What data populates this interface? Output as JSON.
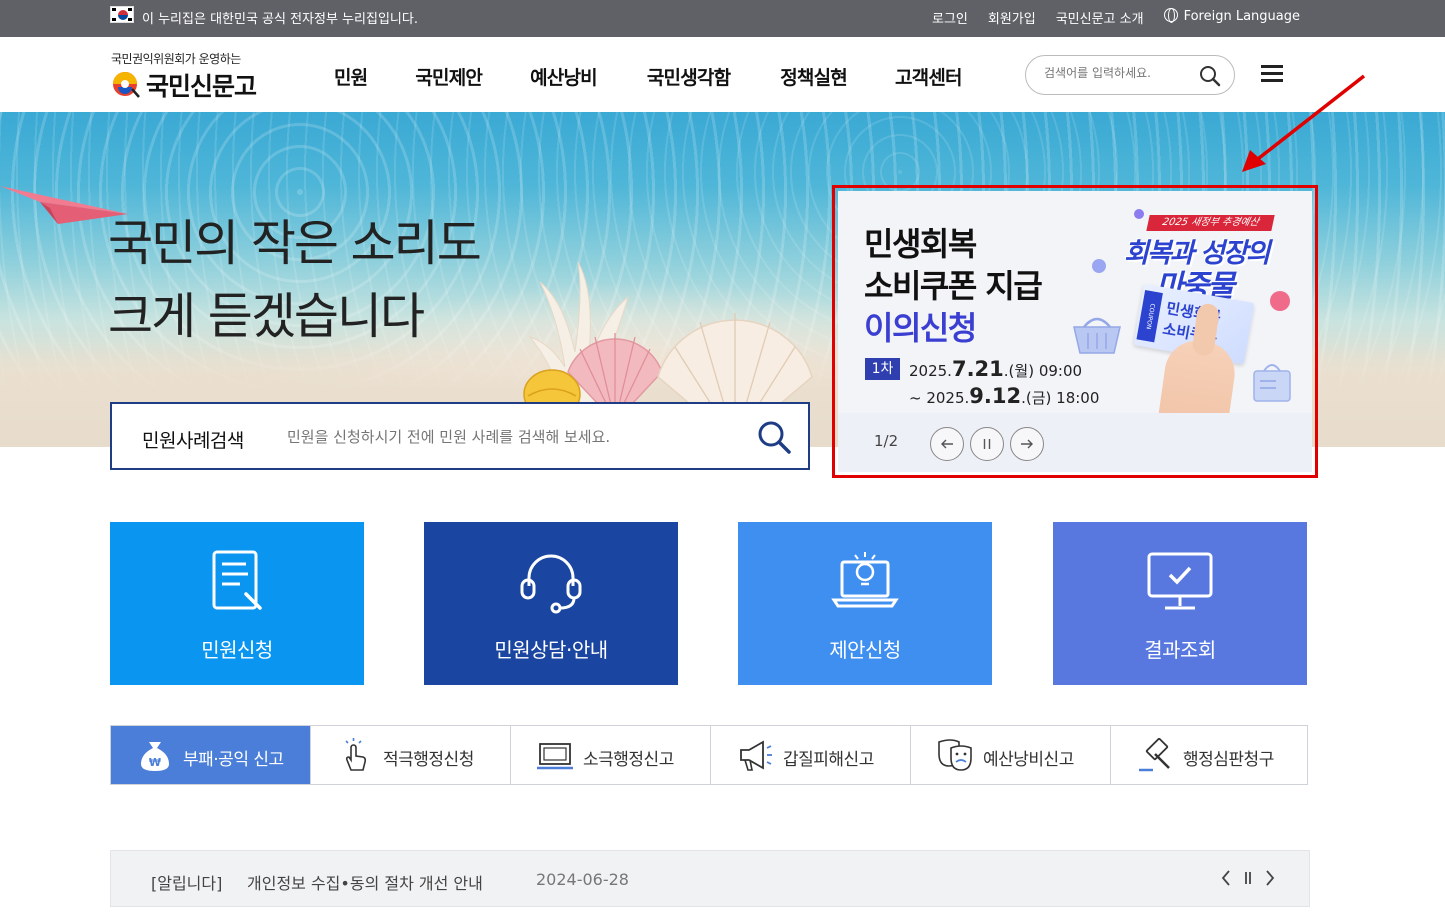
{
  "gov_bar": {
    "notice": "이 누리집은 대한민국 공식 전자정부 누리집입니다.",
    "links": [
      "로그인",
      "회원가입",
      "국민신문고 소개",
      "Foreign Language"
    ]
  },
  "header": {
    "logo_sub": "국민권익위원회가 운영하는",
    "logo_text": "국민신문고",
    "nav": [
      "민원",
      "국민제안",
      "예산낭비",
      "국민생각함",
      "정책실현",
      "고객센터"
    ],
    "search_placeholder": "검색어를 입력하세요."
  },
  "hero": {
    "title_line1": "국민의 작은 소리도",
    "title_line2": "크게 듣겠습니다"
  },
  "banner": {
    "title_line1": "민생회복",
    "title_line2": "소비쿠폰 지급",
    "title_line3": "이의신청",
    "badge": "1차",
    "date1_prefix": "2025.",
    "date1_day": "7.21",
    "date1_suffix": ".(월) 09:00",
    "date2_prefix": "~ 2025.",
    "date2_day": "9.12",
    "date2_suffix": ".(금) 18:00",
    "promo_tag": "2025 새정부 추경예산",
    "promo_line1": "회복과 성장의",
    "promo_line2": "마중물",
    "coupon_side": "COUPON",
    "coupon_line1": "민생회복",
    "coupon_line2": "소비쿠폰",
    "page": "1/2",
    "colors": {
      "accent": "#3b3fd1",
      "badge": "#2f3fb0",
      "outline": "#e00000"
    }
  },
  "case_search": {
    "label": "민원사례검색",
    "placeholder": "민원을 신청하시기 전에 민원 사례를 검색해 보세요."
  },
  "tiles": [
    {
      "label": "민원신청",
      "color": "#0a96f0",
      "icon": "document-pen-icon"
    },
    {
      "label": "민원상담·안내",
      "color": "#1a45a0",
      "icon": "headset-icon"
    },
    {
      "label": "제안신청",
      "color": "#3f8ff0",
      "icon": "laptop-lightbulb-icon"
    },
    {
      "label": "결과조회",
      "color": "#5878e0",
      "icon": "monitor-check-icon"
    }
  ],
  "quick_reports": [
    {
      "label": "부패·공익 신고",
      "icon": "money-bag-icon"
    },
    {
      "label": "적극행정신청",
      "icon": "tap-hand-icon"
    },
    {
      "label": "소극행정신고",
      "icon": "laptop-icon"
    },
    {
      "label": "갑질피해신고",
      "icon": "megaphone-icon"
    },
    {
      "label": "예산낭비신고",
      "icon": "masks-icon"
    },
    {
      "label": "행정심판청구",
      "icon": "gavel-icon"
    }
  ],
  "notice": {
    "category": "[알립니다]",
    "title": "개인정보 수집•동의 절차 개선 안내",
    "date": "2024-06-28"
  }
}
